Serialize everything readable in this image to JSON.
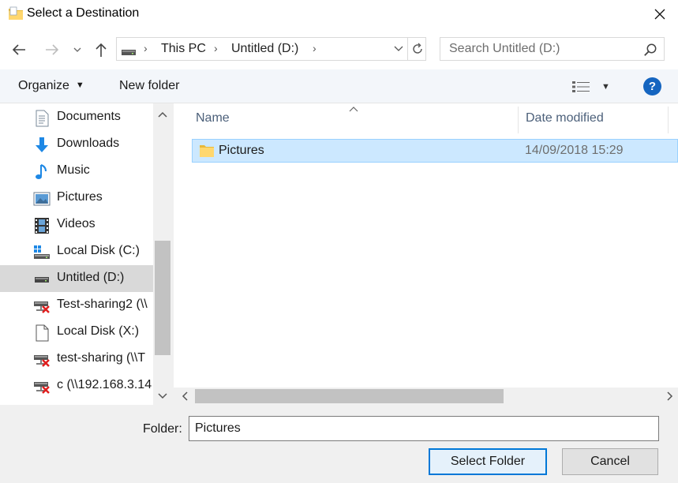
{
  "window": {
    "title": "Select a Destination"
  },
  "address": {
    "crumbs": [
      "This PC",
      "Untitled (D:)"
    ]
  },
  "search": {
    "placeholder": "Search Untitled (D:)"
  },
  "toolbar": {
    "organize_label": "Organize",
    "new_folder_label": "New folder",
    "help_label": "?"
  },
  "nav": {
    "items": [
      {
        "label": "Documents",
        "icon": "documents-icon"
      },
      {
        "label": "Downloads",
        "icon": "downloads-icon"
      },
      {
        "label": "Music",
        "icon": "music-icon"
      },
      {
        "label": "Pictures",
        "icon": "pictures-icon"
      },
      {
        "label": "Videos",
        "icon": "videos-icon"
      },
      {
        "label": "Local Disk (C:)",
        "icon": "windows-drive-icon"
      },
      {
        "label": "Untitled (D:)",
        "icon": "drive-icon",
        "selected": true
      },
      {
        "label": "Test-sharing2 (\\\\",
        "icon": "disconnected-network-drive-icon"
      },
      {
        "label": "Local Disk (X:)",
        "icon": "blank-drive-icon"
      },
      {
        "label": "test-sharing (\\\\T",
        "icon": "disconnected-network-drive-icon"
      },
      {
        "label": "c (\\\\192.168.3.14",
        "icon": "disconnected-network-drive-icon"
      }
    ]
  },
  "content": {
    "columns": [
      "Name",
      "Date modified"
    ],
    "files": [
      {
        "name": "Pictures",
        "date_modified": "14/09/2018 15:29",
        "type": "folder",
        "selected": true
      }
    ]
  },
  "footer": {
    "folder_label": "Folder:",
    "folder_value": "Pictures",
    "select_button": "Select Folder",
    "cancel_button": "Cancel"
  },
  "colors": {
    "selection_bg": "#cce8ff",
    "selection_border": "#99d1ff",
    "accent": "#0078d7",
    "help_blue": "#1565c0",
    "toolbar_bg": "#f3f6fa",
    "column_header": "#4c607a"
  }
}
